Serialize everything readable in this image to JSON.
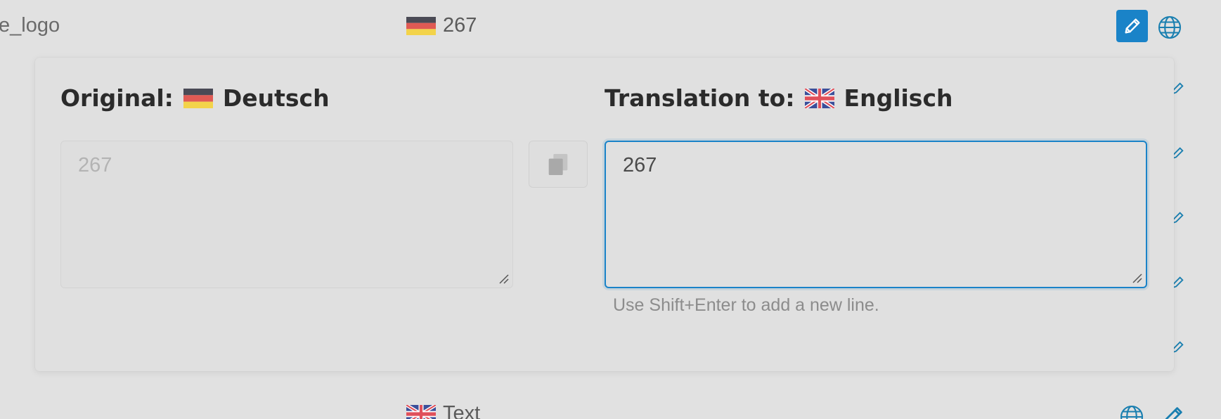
{
  "rows": {
    "top": {
      "key": "e_logo",
      "value": "267",
      "flag": "de-flag"
    },
    "bottom": {
      "value": "Text",
      "flag": "uk-flag"
    }
  },
  "actions": {
    "edit_icon": "pencil-icon",
    "globe_icon": "globe-icon"
  },
  "editor": {
    "original_label": "Original:",
    "original_language": "Deutsch",
    "translation_label": "Translation to:",
    "translation_language": "Englisch",
    "original_value": "267",
    "translation_value": "267",
    "copy_icon": "copy-icon",
    "hint": "Use Shift+Enter to add a new line."
  },
  "colors": {
    "accent": "#1a83c8",
    "background": "#e1e1e1"
  }
}
